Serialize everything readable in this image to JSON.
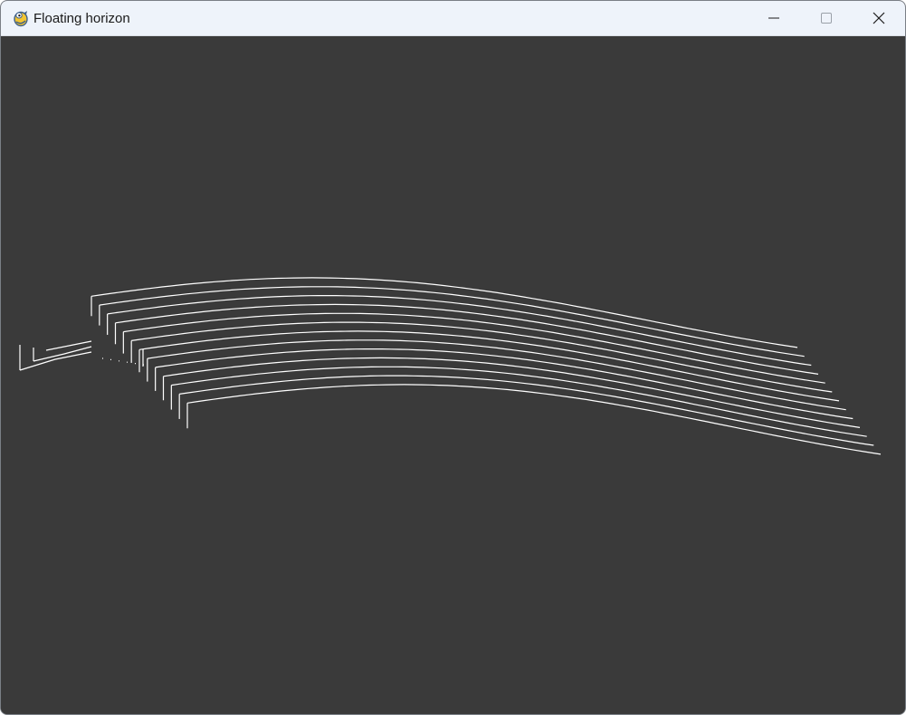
{
  "window": {
    "title": "Floating horizon",
    "app_icon": "pygame-snake-icon",
    "controls": {
      "minimize_icon": "minimize-icon",
      "maximize_icon": "maximize-icon",
      "close_icon": "close-icon"
    }
  },
  "canvas": {
    "background_color": "#3a3a3a",
    "line_color": "#ffffff",
    "content": "floating-horizon-surface-plot"
  },
  "colors": {
    "titlebar": "#eef3fa",
    "title_text": "#1a1a1a"
  }
}
